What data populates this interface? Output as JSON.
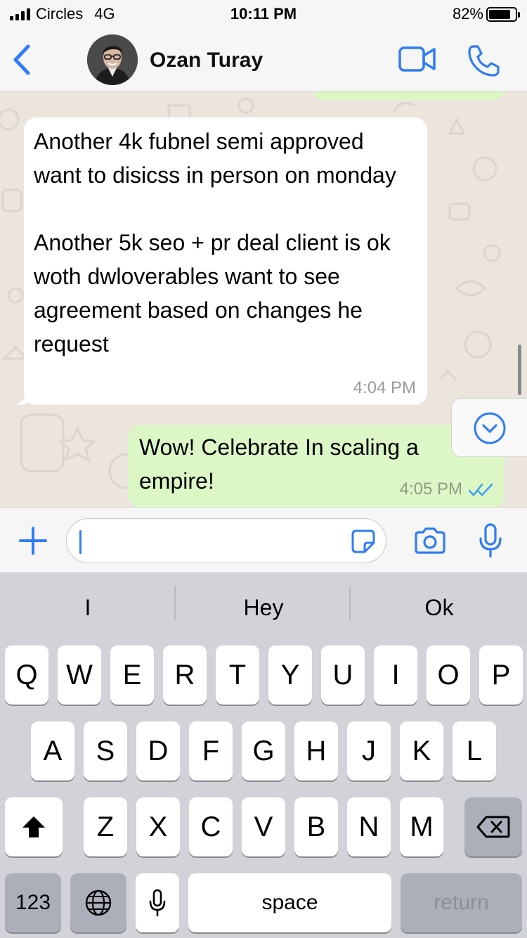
{
  "status_bar": {
    "carrier": "Circles",
    "network": "4G",
    "time": "10:11 PM",
    "battery": "82%",
    "battery_level": 0.82
  },
  "header": {
    "contact_name": "Ozan Turay",
    "icons": [
      "chevron-left-icon",
      "video-camera-icon",
      "phone-icon"
    ]
  },
  "messages": [
    {
      "direction": "incoming",
      "text": "Another 4k fubnel semi approved want to disicss in person on monday\n\nAnother 5k seo + pr deal client is ok woth dwloverables want to see agreement based on changes he request",
      "time": "4:04 PM"
    },
    {
      "direction": "outgoing",
      "text": "Wow! Celebrate In scaling a\nempire!",
      "time": "4:05 PM",
      "status": "read"
    }
  ],
  "composer": {
    "input_value": "",
    "icons": [
      "plus-icon",
      "sticker-icon",
      "camera-icon",
      "microphone-icon"
    ]
  },
  "keyboard": {
    "suggestions": [
      "I",
      "Hey",
      "Ok"
    ],
    "row1": [
      "Q",
      "W",
      "E",
      "R",
      "T",
      "Y",
      "U",
      "I",
      "O",
      "P"
    ],
    "row2": [
      "A",
      "S",
      "D",
      "F",
      "G",
      "H",
      "J",
      "K",
      "L"
    ],
    "row3": [
      "Z",
      "X",
      "C",
      "V",
      "B",
      "N",
      "M"
    ],
    "numbers_label": "123",
    "space_label": "space",
    "return_label": "return"
  },
  "colors": {
    "accent": "#2f7df6",
    "incoming_bubble": "#ffffff",
    "outgoing_bubble": "#dcf7c5",
    "chat_background": "#ebe5de",
    "keyboard_background": "#d1d3d9"
  }
}
